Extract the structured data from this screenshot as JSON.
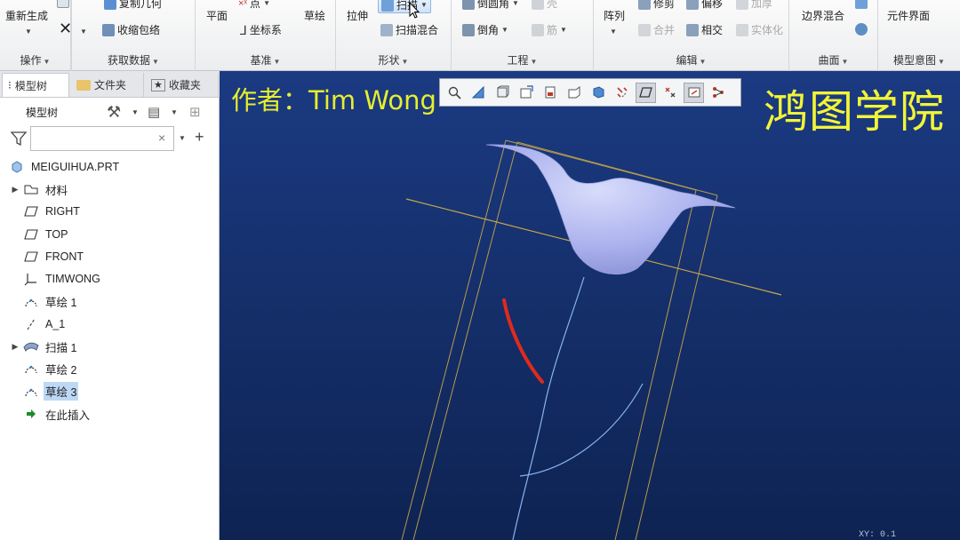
{
  "ribbon": {
    "groups": {
      "operations": "操作",
      "get_data": "获取数据",
      "datum": "基准",
      "shapes": "形状",
      "engineering": "工程",
      "editing": "编辑",
      "surfaces": "曲面",
      "model_intent": "模型意图"
    },
    "buttons": {
      "regenerate": "重新生成",
      "copy_geometry": "复制几何",
      "shrinkwrap": "收缩包络",
      "plane": "平面",
      "point": "点",
      "coordinate_system": "坐标系",
      "sketch": "草绘",
      "extrude": "拉伸",
      "sweep": "扫描",
      "swept_blend": "扫描混合",
      "round": "倒圆角",
      "shell": "壳",
      "chamfer": "倒角",
      "rib": "筋",
      "pattern": "阵列",
      "trim": "修剪",
      "offset": "偏移",
      "thicken": "加厚",
      "merge": "合并",
      "intersect": "相交",
      "solidify": "实体化",
      "boundary_blend": "边界混合",
      "component_interface": "元件界面"
    }
  },
  "left_panel": {
    "tabs": [
      "模型树",
      "文件夹",
      "收藏夹"
    ],
    "tree_header": "模型树",
    "search_placeholder": "",
    "search_clear": "×",
    "root": "MEIGUIHUA.PRT",
    "items": [
      {
        "label": "材料",
        "icon": "material-icon",
        "expandable": true
      },
      {
        "label": "RIGHT",
        "icon": "datum-plane-icon",
        "expandable": false
      },
      {
        "label": "TOP",
        "icon": "datum-plane-icon",
        "expandable": false
      },
      {
        "label": "FRONT",
        "icon": "datum-plane-icon",
        "expandable": false
      },
      {
        "label": "TIMWONG",
        "icon": "coordinate-system-icon",
        "expandable": false
      },
      {
        "label": "草绘 1",
        "icon": "sketch-icon",
        "expandable": false
      },
      {
        "label": "A_1",
        "icon": "datum-axis-icon",
        "expandable": false
      },
      {
        "label": "扫描 1",
        "icon": "sweep-feature-icon",
        "expandable": true
      },
      {
        "label": "草绘 2",
        "icon": "sketch-icon",
        "expandable": false
      },
      {
        "label": "草绘 3",
        "icon": "sketch-icon",
        "expandable": false,
        "selected": true
      },
      {
        "label": "在此插入",
        "icon": "insert-here-icon",
        "expandable": false
      }
    ]
  },
  "viewport": {
    "author": "作者：Tim Wong",
    "brand": "鸿图学院",
    "coords": "XY: 0.1"
  },
  "colors": {
    "viewport_bg": "#15306c",
    "watermark": "#e7ee2d",
    "selected_sketch": "#e02a1c",
    "datum": "#c9a64a",
    "model": "#aeb4ee"
  }
}
